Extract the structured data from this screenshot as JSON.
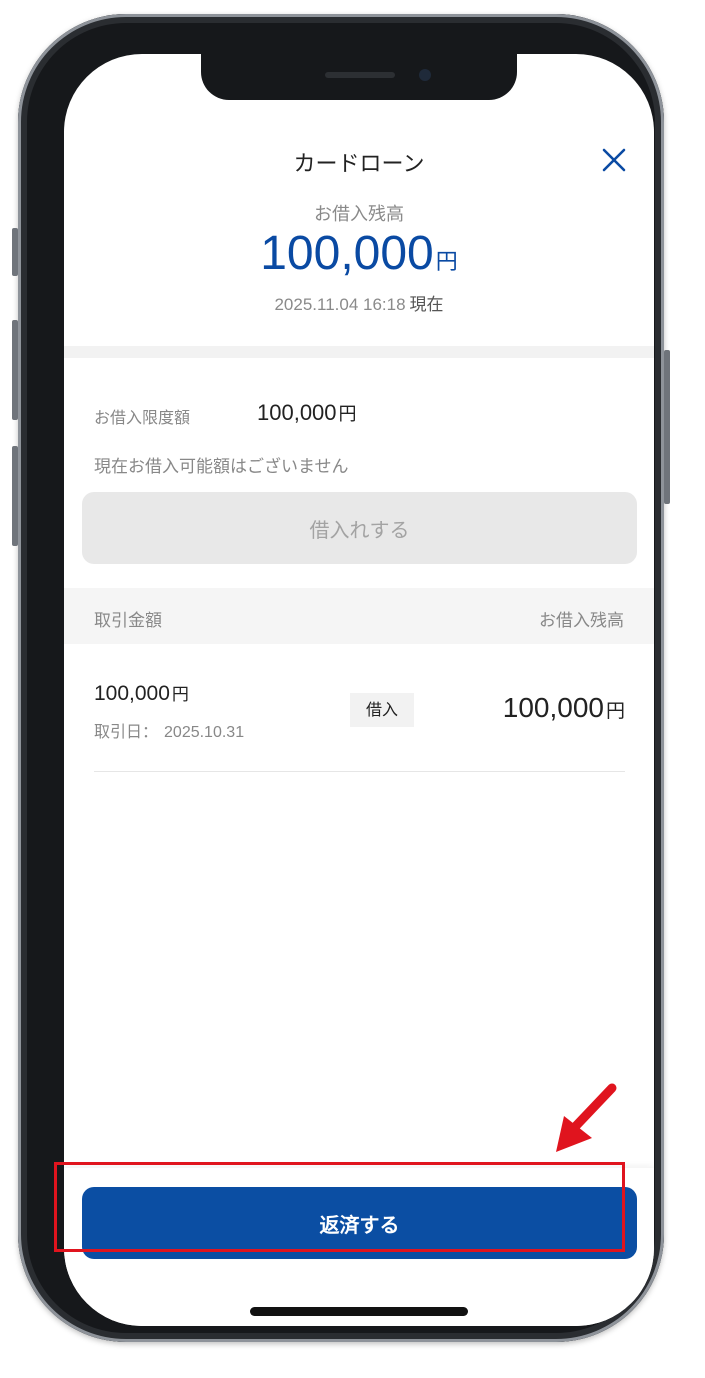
{
  "header": {
    "title": "カードローン",
    "close_icon": "close-icon"
  },
  "summary": {
    "balance_label": "お借入残高",
    "balance_value": "100,000",
    "balance_unit": "円",
    "as_of_timestamp": "2025.11.04 16:18",
    "as_of_suffix": "現在",
    "accent_color": "#0a4aa3"
  },
  "limit": {
    "label": "お借入限度額",
    "value": "100,000",
    "unit": "円",
    "note": "現在お借入可能額はございません"
  },
  "borrow_button": {
    "label": "借入れする",
    "state": "disabled"
  },
  "table": {
    "columns": [
      "取引金額",
      "お借入残高"
    ],
    "rows": [
      {
        "amount": "100,000",
        "amount_unit": "円",
        "date_label": "取引日：",
        "date": "2025.10.31",
        "type": "借入",
        "balance": "100,000",
        "balance_unit": "円"
      }
    ]
  },
  "repay_button": {
    "label": "返済する",
    "color": "#0b4ea3"
  },
  "annotation": {
    "highlight_color": "#e0141e",
    "arrow_icon": "red-arrow-icon"
  }
}
